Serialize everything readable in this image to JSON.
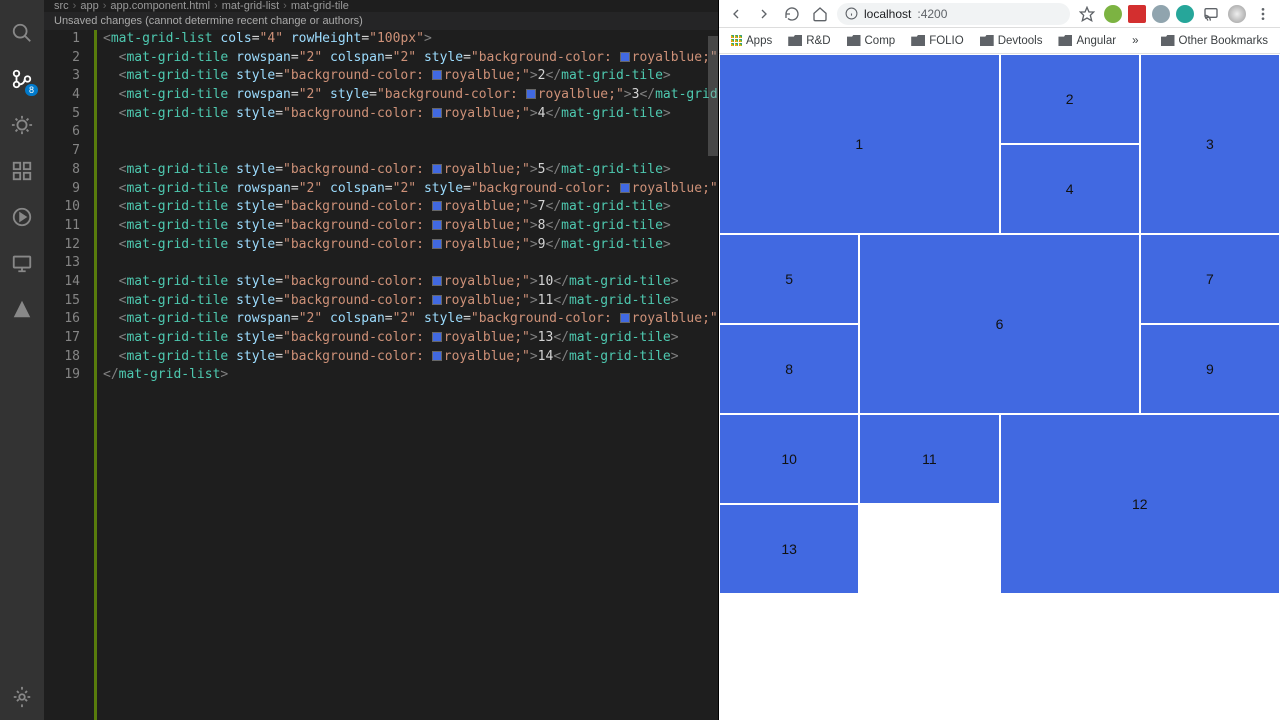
{
  "breadcrumb": {
    "p0": "src",
    "p1": "app",
    "p2": "app.component.html",
    "p3": "mat-grid-list",
    "p4": "mat-grid-tile"
  },
  "editor": {
    "scm_message": "Unsaved changes (cannot determine recent change or authors)",
    "scm_badge": "8",
    "line_numbers": [
      "1",
      "2",
      "3",
      "4",
      "5",
      "6",
      "7",
      "8",
      "9",
      "10",
      "11",
      "12",
      "13",
      "14",
      "15",
      "16",
      "17",
      "18",
      "19"
    ],
    "code": {
      "l1": {
        "tag": "mat-grid-list",
        "a1": "cols",
        "v1": "4",
        "a2": "rowHeight",
        "v2": "100px"
      },
      "l2": {
        "tag": "mat-grid-tile",
        "a1": "rowspan",
        "v1": "2",
        "a2": "colspan",
        "v2": "2",
        "a3": "style",
        "v3": "background-color:",
        "c": "royalblue;"
      },
      "l3": {
        "tag": "mat-grid-tile",
        "a1": "style",
        "v1": "background-color:",
        "c": "royalblue;",
        "t": "2"
      },
      "l4": {
        "tag": "mat-grid-tile",
        "a1": "rowspan",
        "v1": "2",
        "a2": "style",
        "v2": "background-color:",
        "c": "royalblue;",
        "t": "3"
      },
      "l5": {
        "tag": "mat-grid-tile",
        "a1": "style",
        "v1": "background-color:",
        "c": "royalblue;",
        "t": "4"
      },
      "l8": {
        "tag": "mat-grid-tile",
        "a1": "style",
        "v1": "background-color:",
        "c": "royalblue;",
        "t": "5"
      },
      "l9": {
        "tag": "mat-grid-tile",
        "a1": "rowspan",
        "v1": "2",
        "a2": "colspan",
        "v2": "2",
        "a3": "style",
        "v3": "background-color:",
        "c": "royalblue;"
      },
      "l10": {
        "tag": "mat-grid-tile",
        "a1": "style",
        "v1": "background-color:",
        "c": "royalblue;",
        "t": "7"
      },
      "l11": {
        "tag": "mat-grid-tile",
        "a1": "style",
        "v1": "background-color:",
        "c": "royalblue;",
        "t": "8"
      },
      "l12": {
        "tag": "mat-grid-tile",
        "a1": "style",
        "v1": "background-color:",
        "c": "royalblue;",
        "t": "9"
      },
      "l14": {
        "tag": "mat-grid-tile",
        "a1": "style",
        "v1": "background-color:",
        "c": "royalblue;",
        "t": "10"
      },
      "l15": {
        "tag": "mat-grid-tile",
        "a1": "style",
        "v1": "background-color:",
        "c": "royalblue;",
        "t": "11"
      },
      "l16": {
        "tag": "mat-grid-tile",
        "a1": "rowspan",
        "v1": "2",
        "a2": "colspan",
        "v2": "2",
        "a3": "style",
        "v3": "background-color:",
        "c": "royalblue;"
      },
      "l17": {
        "tag": "mat-grid-tile",
        "a1": "style",
        "v1": "background-color:",
        "c": "royalblue;",
        "t": "13"
      },
      "l18": {
        "tag": "mat-grid-tile",
        "a1": "style",
        "v1": "background-color:",
        "c": "royalblue;",
        "t": "14"
      },
      "l19": {
        "tag": "mat-grid-list"
      }
    }
  },
  "browser": {
    "url_host": "localhost",
    "url_port": ":4200",
    "ext_colors": [
      "#7cb342",
      "#d32f2f",
      "#90a4ae",
      "#26a69a"
    ],
    "bookmarks": {
      "apps": "Apps",
      "b0": "R&D",
      "b1": "Comp",
      "b2": "FOLIO",
      "b3": "Devtools",
      "b4": "Angular",
      "more": "»",
      "other": "Other Bookmarks"
    },
    "tiles": {
      "t1": "1",
      "t2": "2",
      "t3": "3",
      "t4": "4",
      "t5": "5",
      "t6": "6",
      "t7": "7",
      "t8": "8",
      "t9": "9",
      "t10": "10",
      "t11": "11",
      "t12": "12",
      "t13": "13"
    }
  }
}
